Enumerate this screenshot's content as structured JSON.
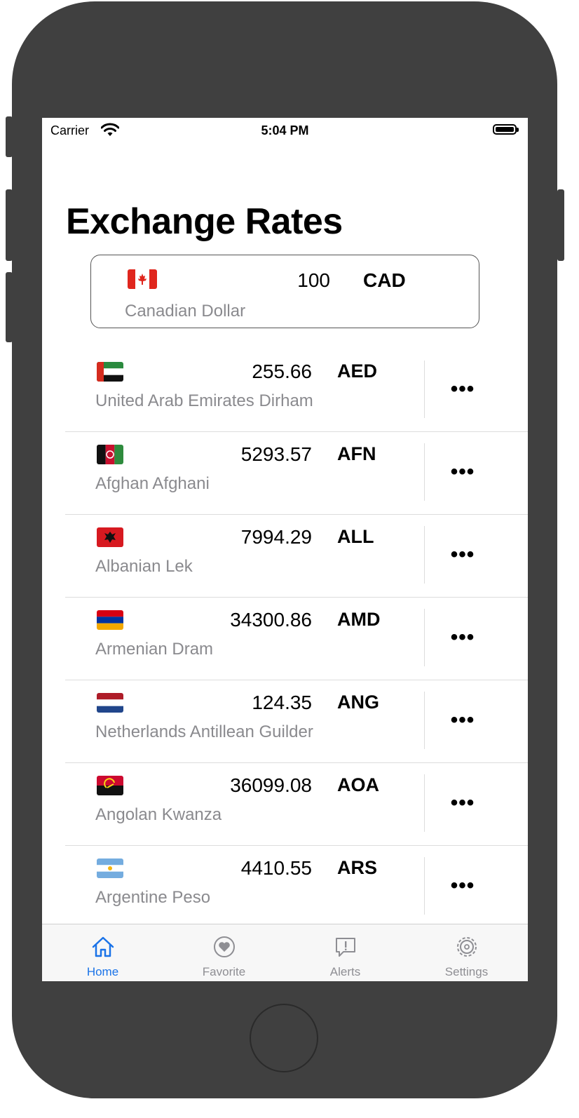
{
  "status_bar": {
    "carrier": "Carrier",
    "time": "5:04 PM"
  },
  "page": {
    "title": "Exchange Rates"
  },
  "base_currency": {
    "flag": "canada-flag-icon",
    "amount": "100",
    "code": "CAD",
    "name": "Canadian Dollar"
  },
  "rates": [
    {
      "flag": "uae-flag-icon",
      "amount": "255.66",
      "code": "AED",
      "name": "United Arab Emirates Dirham",
      "more": "•••"
    },
    {
      "flag": "afghanistan-flag-icon",
      "amount": "5293.57",
      "code": "AFN",
      "name": "Afghan Afghani",
      "more": "•••"
    },
    {
      "flag": "albania-flag-icon",
      "amount": "7994.29",
      "code": "ALL",
      "name": "Albanian Lek",
      "more": "•••"
    },
    {
      "flag": "armenia-flag-icon",
      "amount": "34300.86",
      "code": "AMD",
      "name": "Armenian Dram",
      "more": "•••"
    },
    {
      "flag": "netherlands-flag-icon",
      "amount": "124.35",
      "code": "ANG",
      "name": "Netherlands Antillean Guilder",
      "more": "•••"
    },
    {
      "flag": "angola-flag-icon",
      "amount": "36099.08",
      "code": "AOA",
      "name": "Angolan Kwanza",
      "more": "•••"
    },
    {
      "flag": "argentina-flag-icon",
      "amount": "4410.55",
      "code": "ARS",
      "name": "Argentine Peso",
      "more": "•••"
    }
  ],
  "tabs": [
    {
      "label": "Home",
      "icon": "house-icon",
      "active": true
    },
    {
      "label": "Favorite",
      "icon": "heart-icon",
      "active": false
    },
    {
      "label": "Alerts",
      "icon": "alert-bubble-icon",
      "active": false
    },
    {
      "label": "Settings",
      "icon": "gear-icon",
      "active": false
    }
  ],
  "colors": {
    "accent": "#1a73e8",
    "secondary_text": "#8a8a8e",
    "device_body": "#404040"
  }
}
